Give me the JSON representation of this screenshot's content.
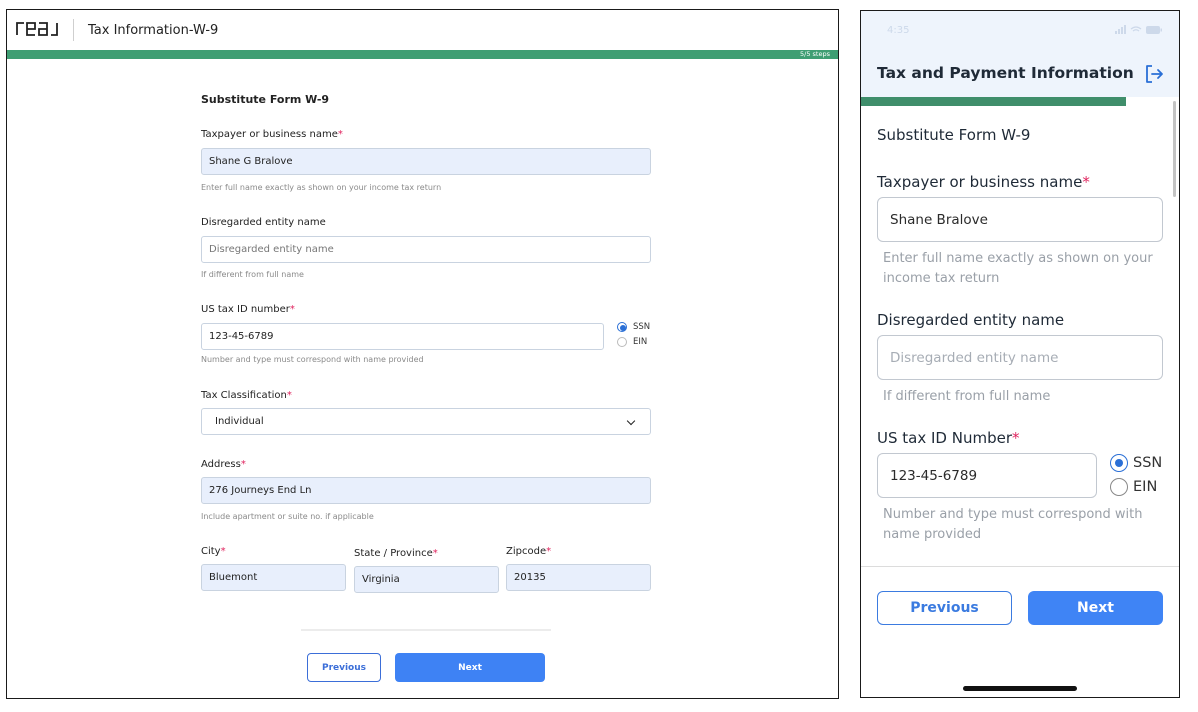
{
  "desktop": {
    "logo": "real",
    "title": "Tax Information-W-9",
    "progress_label": "5/5 steps",
    "form": {
      "heading": "Substitute Form W-9",
      "taxpayer_label": "Taxpayer or business name",
      "taxpayer_value": "Shane G Bralove",
      "taxpayer_hint": "Enter full name exactly as shown on your income tax return",
      "disregarded_label": "Disregarded entity name",
      "disregarded_placeholder": "Disregarded entity name",
      "disregarded_hint": "If different from full name",
      "taxid_label": "US tax ID number",
      "taxid_value": "123-45-6789",
      "taxid_hint": "Number and type must correspond with name provided",
      "radio_ssn": "SSN",
      "radio_ein": "EIN",
      "classification_label": "Tax Classification",
      "classification_value": "Individual",
      "address_label": "Address",
      "address_value": "276 Journeys End Ln",
      "address_hint": "Include apartment or suite no. if applicable",
      "city_label": "City",
      "city_value": "Bluemont",
      "state_label": "State / Province",
      "state_value": "Virginia",
      "zip_label": "Zipcode",
      "zip_value": "20135",
      "required_mark": "*"
    },
    "buttons": {
      "previous": "Previous",
      "next": "Next"
    }
  },
  "mobile": {
    "status_time": "4:35",
    "header_title": "Tax and Payment Information",
    "form": {
      "heading": "Substitute Form W-9",
      "taxpayer_label": "Taxpayer or business name",
      "taxpayer_value": "Shane Bralove",
      "taxpayer_hint": "Enter full name exactly as shown on your income tax return",
      "disregarded_label": "Disregarded entity name",
      "disregarded_placeholder": "Disregarded entity name",
      "disregarded_hint": "If different from full name",
      "taxid_label": "US tax ID Number",
      "taxid_value": "123-45-6789",
      "taxid_hint": "Number and type must correspond with name provided",
      "radio_ssn": "SSN",
      "radio_ein": "EIN",
      "required_mark": "*"
    },
    "buttons": {
      "previous": "Previous",
      "next": "Next"
    }
  },
  "colors": {
    "progress_green": "#3f9e73",
    "primary_blue": "#3e82f4",
    "filled_field_bg": "#e8effc",
    "required_red": "#e0245e"
  },
  "icons": [
    "chevron-down-icon",
    "logout-icon",
    "radio-selected-icon",
    "radio-unselected-icon"
  ]
}
